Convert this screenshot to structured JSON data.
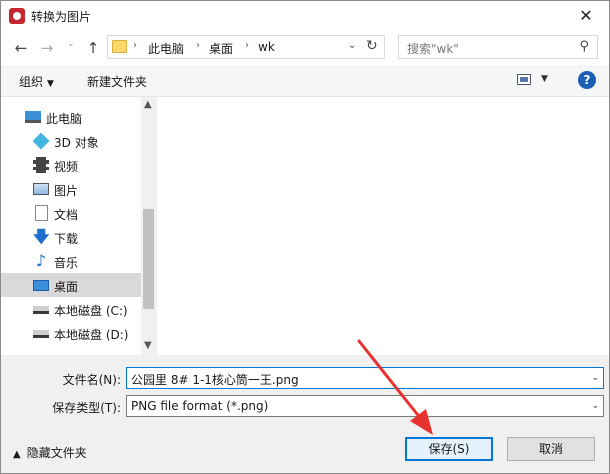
{
  "window": {
    "title": "转换为图片",
    "close_glyph": "✕"
  },
  "nav": {
    "back_glyph": "←",
    "forward_glyph": "→",
    "history_glyph": "⌄",
    "up_glyph": "↑",
    "breadcrumb": [
      "此电脑",
      "桌面",
      "wk"
    ],
    "crumb_sep": "›",
    "dropdown_glyph": "⌄",
    "refresh_glyph": "↻",
    "search_placeholder": "搜索\"wk\"",
    "search_glyph": "⚲"
  },
  "toolbar": {
    "organize_label": "组织",
    "organize_caret": "▼",
    "new_folder_label": "新建文件夹",
    "view_caret": "▼",
    "help_glyph": "?"
  },
  "sidebar": {
    "items": [
      {
        "label": "此电脑",
        "icon": "computer-icon"
      },
      {
        "label": "3D 对象",
        "icon": "3d-objects-icon"
      },
      {
        "label": "视频",
        "icon": "video-icon"
      },
      {
        "label": "图片",
        "icon": "pictures-icon"
      },
      {
        "label": "文档",
        "icon": "documents-icon"
      },
      {
        "label": "下载",
        "icon": "downloads-icon",
        "glyph": "🡇"
      },
      {
        "label": "音乐",
        "icon": "music-icon",
        "glyph": "♪"
      },
      {
        "label": "桌面",
        "icon": "desktop-icon",
        "selected": true
      },
      {
        "label": "本地磁盘 (C:)",
        "icon": "drive-icon"
      },
      {
        "label": "本地磁盘 (D:)",
        "icon": "drive-icon"
      }
    ],
    "scroll_up_glyph": "▲",
    "scroll_down_glyph": "▼"
  },
  "form": {
    "filename_label": "文件名(N):",
    "filename_value": "公园里 8# 1-1核心筒一王.png",
    "filetype_label": "保存类型(T):",
    "filetype_value": "PNG file format (*.png)",
    "dropdown_glyph": "⌄"
  },
  "footer": {
    "hide_folders_label": "隐藏文件夹",
    "hide_caret": "▲",
    "save_label": "保存(S)",
    "cancel_label": "取消"
  },
  "colors": {
    "accent": "#0078d7",
    "arrow": "#e8322f",
    "selected": "#d9d9d9",
    "brand": "#c6262e"
  }
}
